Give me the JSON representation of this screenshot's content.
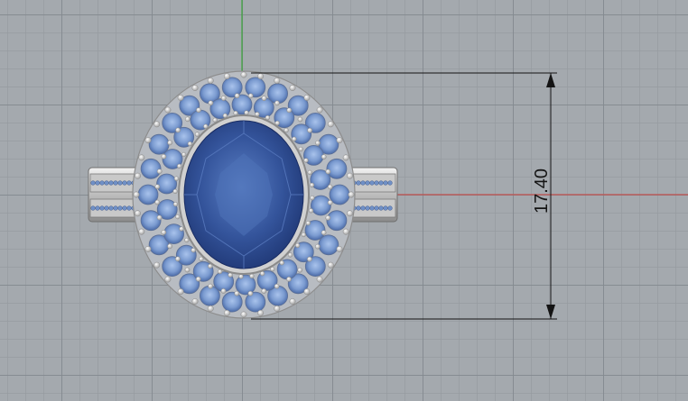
{
  "viewport": {
    "background": "#a4a9ae",
    "grid_line_color": "#8a9095",
    "x_axis_color": "#c0504d",
    "y_axis_color": "#3aa33a",
    "view": "top"
  },
  "model": {
    "object": "halo-ring",
    "center_stone_color": "#2e4f96",
    "halo_stone_color": "#7f9fd2",
    "metal_color": "#d7d7d7"
  },
  "dimension": {
    "value": "17.40",
    "orientation": "vertical",
    "line_color": "#141414"
  }
}
